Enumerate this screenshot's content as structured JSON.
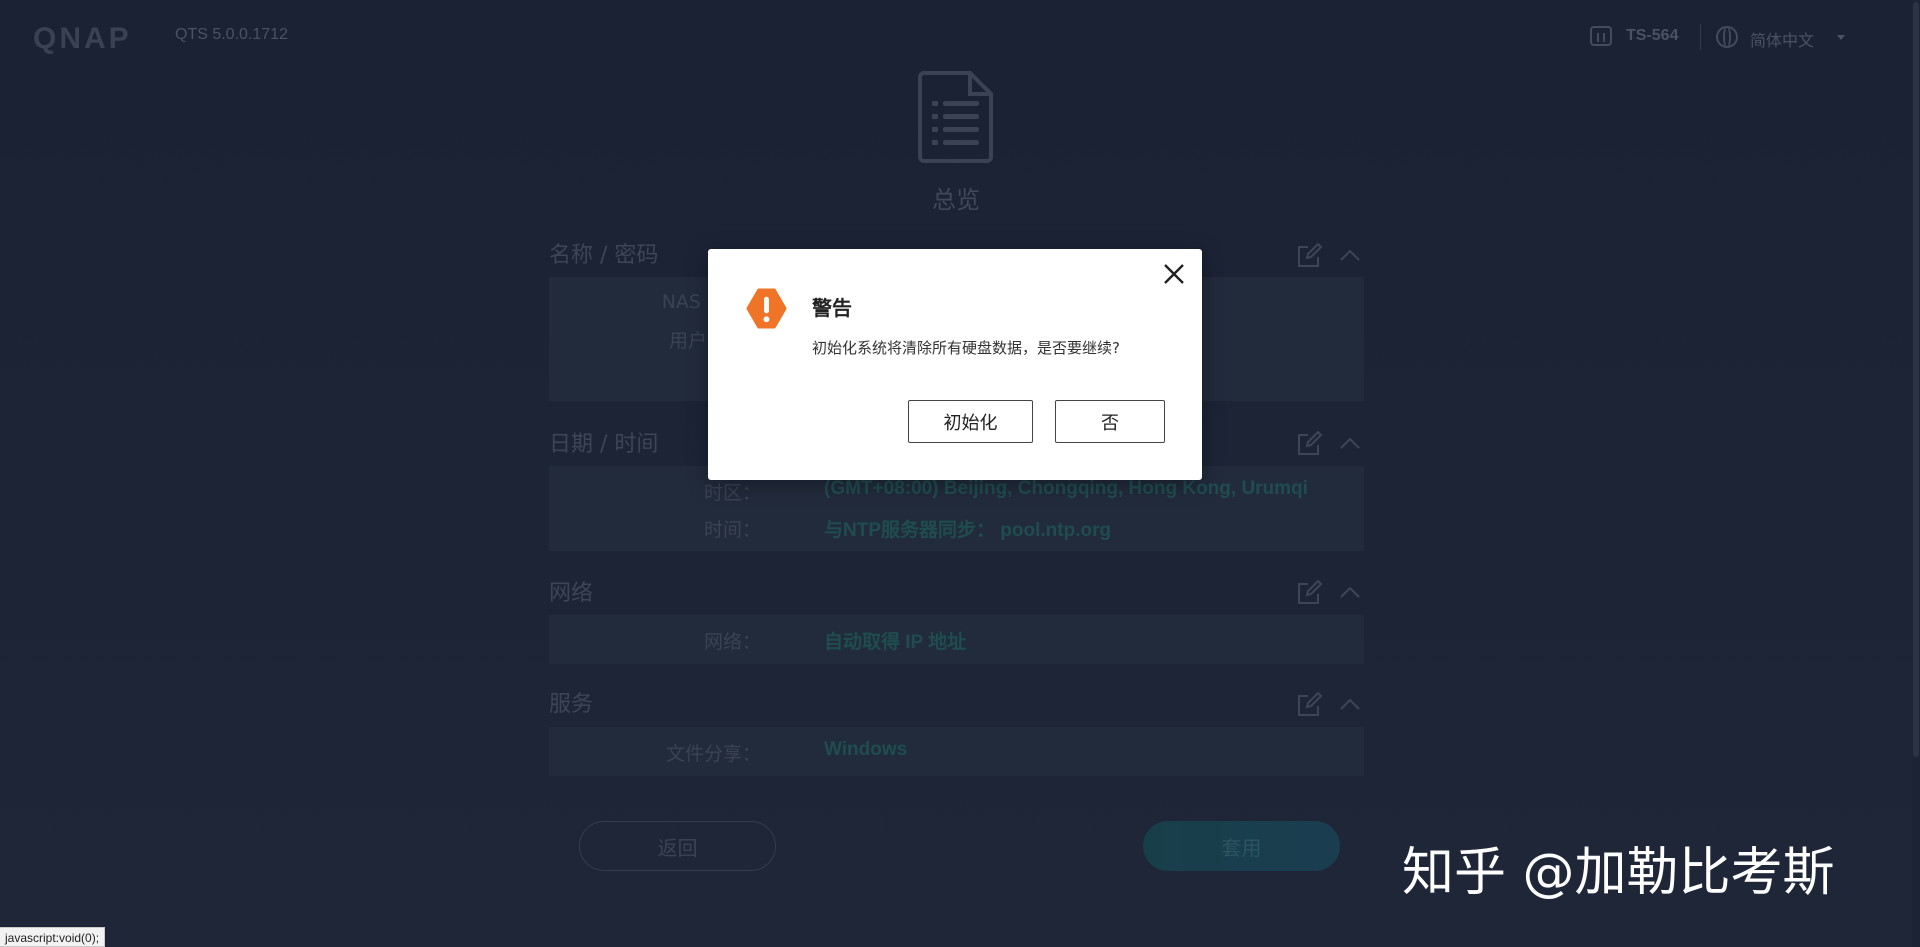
{
  "header": {
    "logo": "QNAP",
    "version": "QTS 5.0.0.1712",
    "device_name": "TS-564",
    "language": "简体中文"
  },
  "page": {
    "title": "总览"
  },
  "sections": {
    "name_password": {
      "title": "名称 / 密码",
      "rows": [
        {
          "label": "NAS",
          "value": ""
        },
        {
          "label": "用户",
          "value": ""
        }
      ]
    },
    "datetime": {
      "title": "日期 / 时间",
      "rows": [
        {
          "label": "时区：",
          "value": "(GMT+08:00) Beijing, Chongqing, Hong Kong, Urumqi"
        },
        {
          "label": "时间：",
          "value": "与NTP服务器同步： pool.ntp.org"
        }
      ]
    },
    "network": {
      "title": "网络",
      "rows": [
        {
          "label": "网络：",
          "value": "自动取得 IP 地址"
        }
      ]
    },
    "services": {
      "title": "服务",
      "rows": [
        {
          "label": "文件分享：",
          "value": "Windows"
        }
      ]
    }
  },
  "footer": {
    "back_label": "返回",
    "apply_label": "套用"
  },
  "modal": {
    "title": "警告",
    "message": "初始化系统将清除所有硬盘数据，是否要继续?",
    "confirm_label": "初始化",
    "cancel_label": "否",
    "warning_color": "#f07427"
  },
  "watermark": "知乎 @加勒比考斯",
  "status_bar": "javascript:void(0);",
  "colors": {
    "background": "#1c2436",
    "section_box": "#222b3c",
    "value_text": "#1f4d4f",
    "apply_button": "#173f4a"
  }
}
